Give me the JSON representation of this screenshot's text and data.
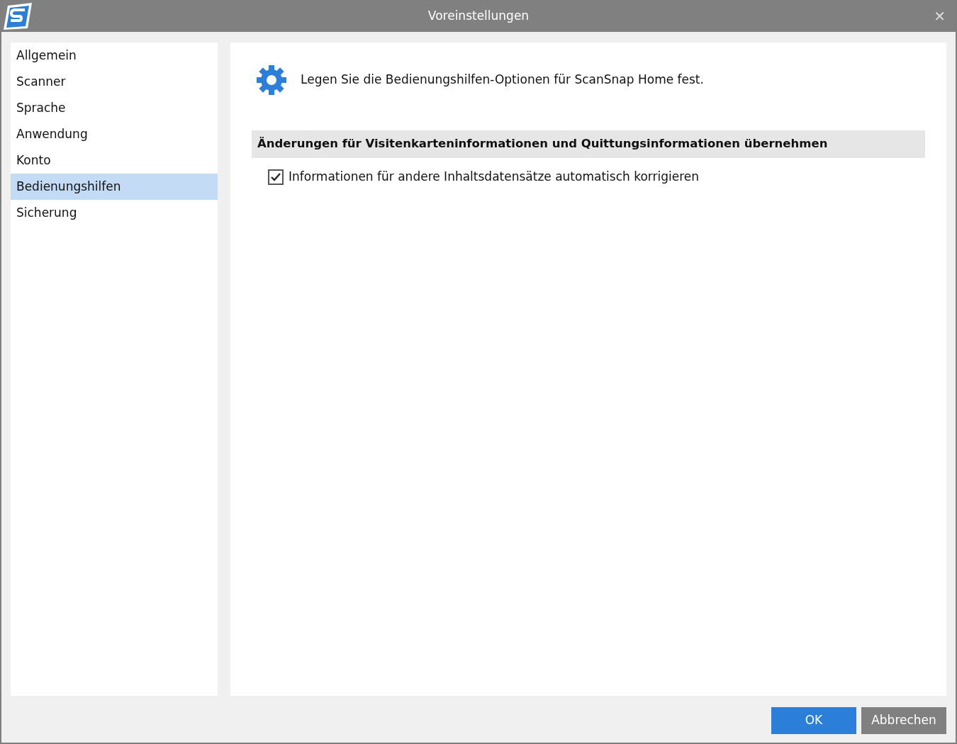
{
  "window": {
    "title": "Voreinstellungen",
    "close": "✕"
  },
  "sidebar": {
    "items": [
      {
        "label": "Allgemein",
        "selected": false
      },
      {
        "label": "Scanner",
        "selected": false
      },
      {
        "label": "Sprache",
        "selected": false
      },
      {
        "label": "Anwendung",
        "selected": false
      },
      {
        "label": "Konto",
        "selected": false
      },
      {
        "label": "Bedienungshilfen",
        "selected": true
      },
      {
        "label": "Sicherung",
        "selected": false
      }
    ]
  },
  "content": {
    "intro": "Legen Sie die Bedienungshilfen-Optionen für ScanSnap Home fest.",
    "section_title": "Änderungen für Visitenkarteninformationen und Quittungsinformationen übernehmen",
    "options": [
      {
        "label": "Informationen für andere Inhaltsdatensätze automatisch korrigieren",
        "checked": true
      }
    ]
  },
  "buttons": [
    {
      "label": "OK",
      "kind": "primary"
    },
    {
      "label": "Abbrechen",
      "kind": "secondary"
    }
  ]
}
